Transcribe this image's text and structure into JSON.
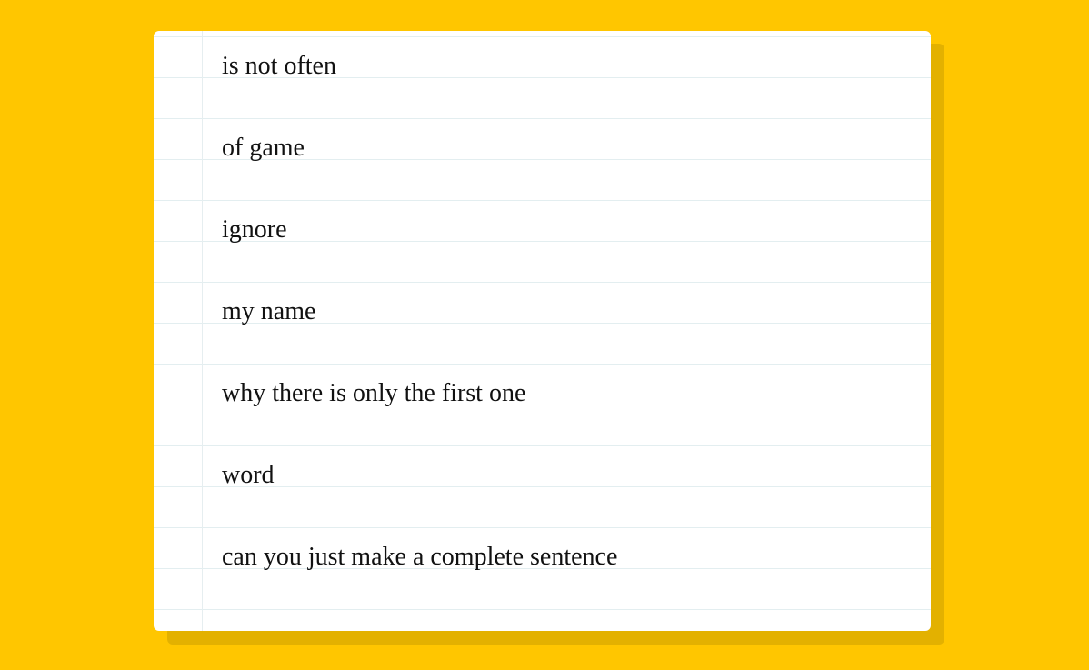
{
  "notebook": {
    "lines": [
      "is not often",
      "of game",
      "ignore",
      "my name",
      "why there is only the first one",
      "word",
      "can you just make a complete sentence"
    ]
  },
  "colors": {
    "background": "#ffc600",
    "shadow": "#e3b100",
    "paper": "#ffffff",
    "rule_line": "#e3eef0",
    "text": "#111111"
  }
}
